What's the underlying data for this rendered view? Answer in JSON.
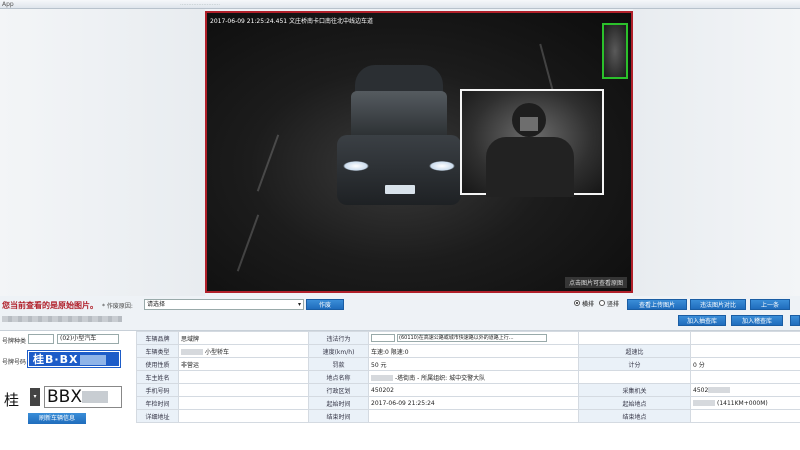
{
  "top": {
    "app": "App"
  },
  "photo": {
    "stamp": "2017-06-09 21:25:24.451 文庄桥南卡口南往北中线边车道",
    "hint": "点击图片可查看原图"
  },
  "toolbar": {
    "prompt": "您当前查看的是原始图片。",
    "reason_label": "* 作废原因:",
    "reason_value": "请选择",
    "void_button": "作废",
    "radio_default": "横排",
    "radio_other": "竖排",
    "view_upload_button": "查看上传图片",
    "compare_button": "违法图片对比",
    "prev_button": "上一条",
    "add_check_button": "加入抽查库",
    "add_review_button": "加入稽查库"
  },
  "left": {
    "plate_type_label": "号牌种类",
    "plate_type_value": "(02)小型汽车",
    "plate_number_label": "号牌号码",
    "plate_image_text": "桂B·BX",
    "province": "桂",
    "plate_chars": "BBX",
    "refresh_button": "刷新车辆信息"
  },
  "grid": {
    "rows": [
      [
        "车辆品牌",
        "思域牌",
        "违法行为",
        "(60110)在高速公路或城市快速路以外的道路上行...",
        "",
        ""
      ],
      [
        "车辆类型",
        "小型轿车",
        "速度(km/h)",
        "车速:0  限速:0",
        "超速比",
        ""
      ],
      [
        "使用性质",
        "非营运",
        "罚款",
        "50 元",
        "计分",
        "0 分"
      ],
      [
        "车主姓名",
        "",
        "地点名称",
        "-塔街南 - 所属组织: 城中交警大队",
        "",
        ""
      ],
      [
        "手机号码",
        "",
        "行政区划",
        "450202",
        "采集机关",
        "4502"
      ],
      [
        "年检时间",
        "",
        "起始时间",
        "2017-06-09 21:25:24",
        "起始地点",
        "(1411KM+000M)"
      ],
      [
        "详细地址",
        "",
        "结束时间",
        "",
        "结束地点",
        ""
      ]
    ]
  }
}
